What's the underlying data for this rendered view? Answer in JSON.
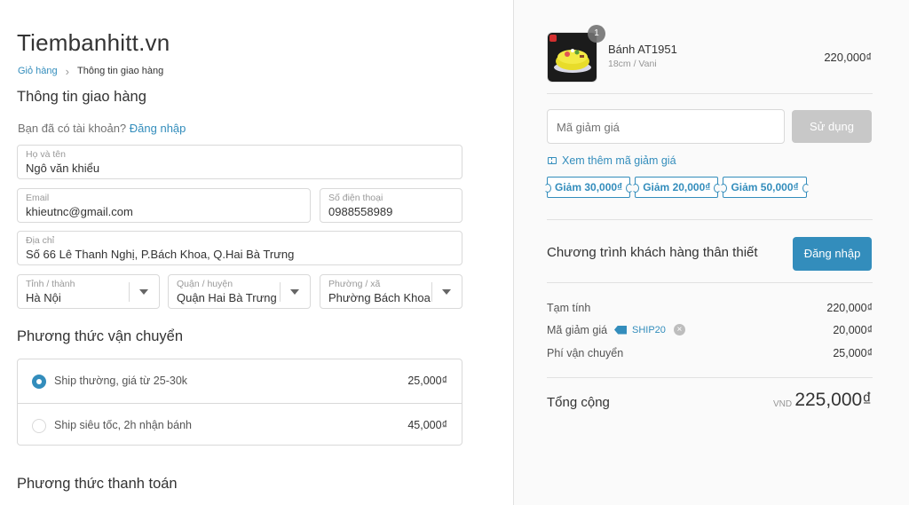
{
  "store": {
    "name": "Tiembanhitt.vn"
  },
  "breadcrumb": {
    "cart": "Giỏ hàng",
    "current": "Thông tin giao hàng"
  },
  "shipping_info": {
    "title": "Thông tin giao hàng",
    "account_prompt": "Bạn đã có tài khoản?",
    "login_link": "Đăng nhập",
    "full_name": {
      "label": "Họ và tên",
      "value": "Ngô văn khiểu"
    },
    "email": {
      "label": "Email",
      "value": "khieutnc@gmail.com"
    },
    "phone": {
      "label": "Số điện thoại",
      "value": "0988558989"
    },
    "address": {
      "label": "Địa chỉ",
      "value": "Số 66 Lê Thanh Nghị, P.Bách Khoa, Q.Hai Bà Trưng"
    },
    "province": {
      "label": "Tỉnh / thành",
      "value": "Hà Nội"
    },
    "district": {
      "label": "Quận / huyện",
      "value": "Quận Hai Bà Trưng"
    },
    "ward": {
      "label": "Phường / xã",
      "value": "Phường Bách Khoa"
    }
  },
  "shipping_method": {
    "title": "Phương thức vận chuyển",
    "options": [
      {
        "label": "Ship thường, giá từ 25-30k",
        "price": "25,000₫",
        "selected": true
      },
      {
        "label": "Ship siêu tốc, 2h nhận bánh",
        "price": "45,000₫",
        "selected": false
      }
    ]
  },
  "payment_method": {
    "title": "Phương thức thanh toán"
  },
  "order": {
    "product": {
      "name": "Bánh AT1951",
      "variant": "18cm / Vani",
      "price": "220,000₫",
      "quantity": "1"
    },
    "discount": {
      "placeholder": "Mã giảm giá",
      "apply_label": "Sử dụng",
      "more_link": "Xem thêm mã giảm giá",
      "chips": [
        "Giảm 30,000₫",
        "Giảm 20,000₫",
        "Giảm 50,000₫"
      ]
    },
    "loyalty": {
      "text": "Chương trình khách hàng thân thiết",
      "button": "Đăng nhập"
    },
    "summary": {
      "subtotal_label": "Tạm tính",
      "subtotal_value": "220,000₫",
      "discount_label": "Mã giảm giá",
      "discount_code": "SHIP20",
      "discount_value": "20,000₫",
      "shipping_label": "Phí vận chuyển",
      "shipping_value": "25,000₫",
      "total_label": "Tổng cộng",
      "currency": "VND",
      "total_value": "225,000₫"
    }
  },
  "colors": {
    "accent": "#338dbc",
    "disabled_button": "#c8c8c8",
    "panel_bg": "#fafafa",
    "border": "#d9d9d9"
  }
}
